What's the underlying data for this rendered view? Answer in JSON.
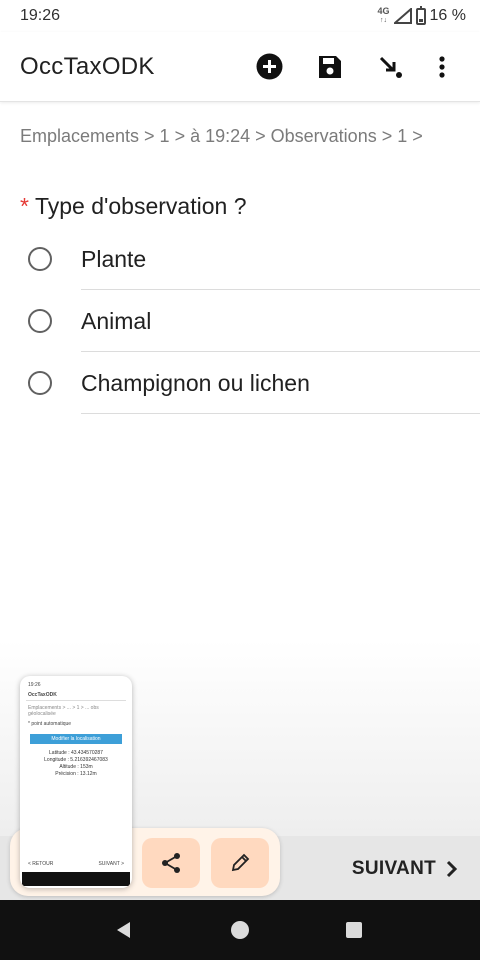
{
  "status_bar": {
    "time": "19:26",
    "network": "4G",
    "network_sub": "↑↓",
    "battery": "16 %"
  },
  "app_bar": {
    "title": "OccTaxODK",
    "icons": [
      "add-circle-icon",
      "save-icon",
      "jump-icon",
      "more-vert-icon"
    ]
  },
  "breadcrumb": "Emplacements > 1 > à 19:24 > Observations > 1 >",
  "question": {
    "required_marker": "*",
    "label": "Type d'observation ?"
  },
  "options": [
    {
      "label": "Plante"
    },
    {
      "label": "Animal"
    },
    {
      "label": "Champignon ou lichen"
    }
  ],
  "next_button": {
    "label": "SUIVANT"
  },
  "screenshot_preview": {
    "title": "OccTaxODK",
    "time": "19:26",
    "breadcrumb": "Emplacements > ... > 1 > ... obs",
    "breadcrumb2": "géolocalisée",
    "question": "* point automatique",
    "button": "Modifier la localisation",
    "coords": [
      "Latitude : 43.434570287",
      "Longitude : 5.216392467083",
      "Altitude : 153m",
      "Précision : 13.12m"
    ],
    "prev": "< RETOUR",
    "next": "SUIVANT >",
    "actions": [
      "share-icon",
      "edit-icon"
    ]
  },
  "colors": {
    "required": "#e53935",
    "preview_dock": "#fff3e8",
    "preview_button": "#ffd9bf",
    "system_nav": "#111111"
  }
}
